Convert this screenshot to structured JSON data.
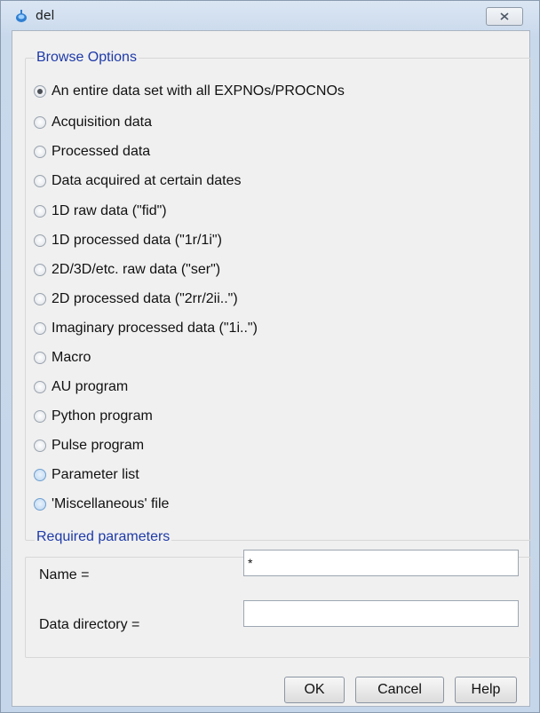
{
  "window": {
    "title": "del"
  },
  "browse": {
    "group_title": "Browse Options",
    "options": [
      {
        "label": "An entire data set with all EXPNOs/PROCNOs",
        "checked": true
      },
      {
        "label": "Acquisition data"
      },
      {
        "label": "Processed data"
      },
      {
        "label": "Data acquired at certain dates"
      },
      {
        "label": "1D raw data (\"fid\")"
      },
      {
        "label": "1D processed data (\"1r/1i\")"
      },
      {
        "label": "2D/3D/etc. raw data (\"ser\")"
      },
      {
        "label": "2D processed data (\"2rr/2ii..\")"
      },
      {
        "label": "Imaginary processed data (\"1i..\")"
      },
      {
        "label": "Macro"
      },
      {
        "label": "AU program"
      },
      {
        "label": "Python program"
      },
      {
        "label": "Pulse program"
      },
      {
        "label": "Parameter list"
      },
      {
        "label": "'Miscellaneous' file"
      }
    ]
  },
  "params": {
    "group_title": "Required parameters",
    "name_label": "Name =",
    "name_value": "*",
    "dir_label": "Data directory =",
    "dir_value": ""
  },
  "buttons": {
    "ok": "OK",
    "cancel": "Cancel",
    "help": "Help"
  }
}
